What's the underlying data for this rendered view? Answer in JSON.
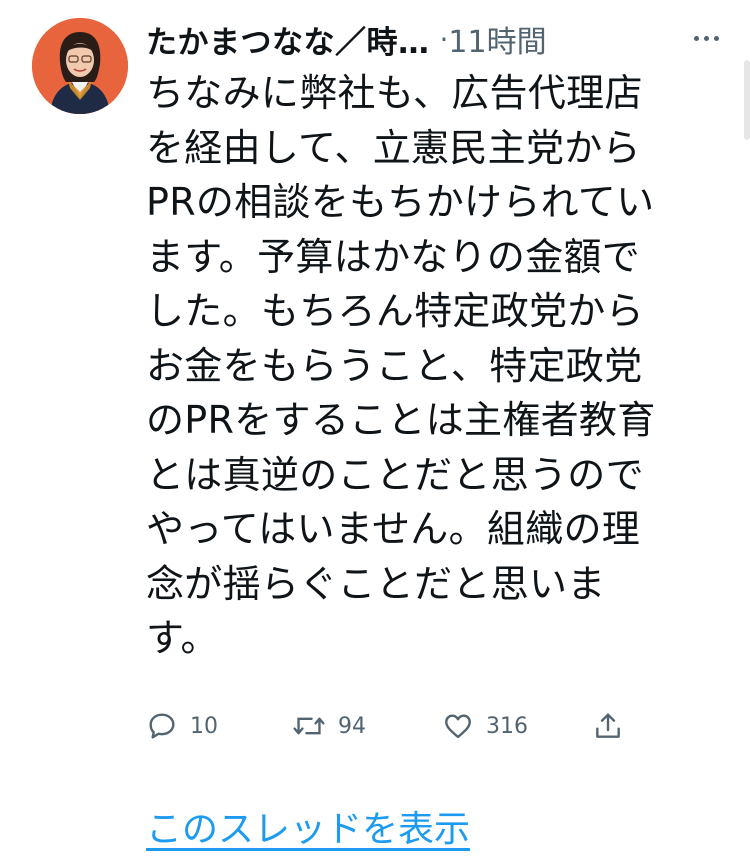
{
  "tweet": {
    "author_name": "たかまつなな／時…",
    "separator": "·",
    "timestamp": "11時間",
    "lines": [
      "ちなみに弊社も、広告代理店",
      "を経由して、立憲民主党から",
      "PRの相談をもちかけられてい",
      "ます。予算はかなりの金額で",
      "した。もちろん特定政党から",
      "お金をもらうこと、特定政党",
      "のPRをすることは主権者教育",
      "とは真逆のことだと思うので",
      "やってはいません。組織の理",
      "念が揺らぐことだと思いま",
      "す。"
    ],
    "actions": {
      "reply_count": "10",
      "retweet_count": "94",
      "like_count": "316"
    },
    "show_thread_label": "このスレッドを表示"
  },
  "colors": {
    "text": "#0f1419",
    "secondary": "#536471",
    "link": "#1d9bf0",
    "avatar_bg": "#e8643c"
  },
  "icons": [
    "more-icon",
    "reply-icon",
    "retweet-icon",
    "like-icon",
    "share-icon"
  ]
}
